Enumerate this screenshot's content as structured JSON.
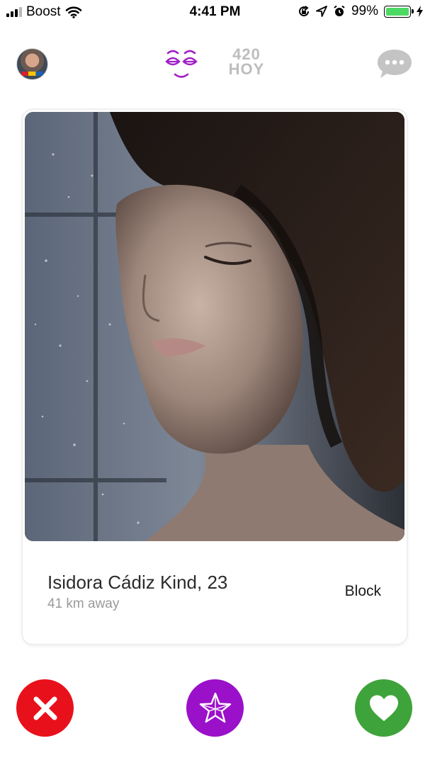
{
  "status_bar": {
    "carrier": "Boost",
    "time": "4:41 PM",
    "battery_percent": "99%",
    "battery_level": 0.99,
    "icons": [
      "signal-icon",
      "wifi-icon",
      "orientation-lock-icon",
      "location-icon",
      "alarm-icon",
      "battery-icon",
      "charging-icon"
    ]
  },
  "header": {
    "avatar_icon": "profile-avatar",
    "logo_icon": "sleepy-eyes-logo-icon",
    "brand_line1": "420",
    "brand_line2": "HOY",
    "chat_icon": "chat-bubble-icon",
    "logo_color": "#a21fc8",
    "muted_color": "#bdbdbd"
  },
  "profile_card": {
    "name_age": "Isidora Cádiz Kind, 23",
    "distance": "41 km away",
    "block_label": "Block",
    "photo_subject": "profile-photo"
  },
  "actions": {
    "nope_icon": "close-icon",
    "super_icon": "star-icon",
    "like_icon": "heart-icon",
    "nope_color": "#e8101a",
    "super_color": "#9b10c9",
    "like_color": "#3ea33b"
  }
}
